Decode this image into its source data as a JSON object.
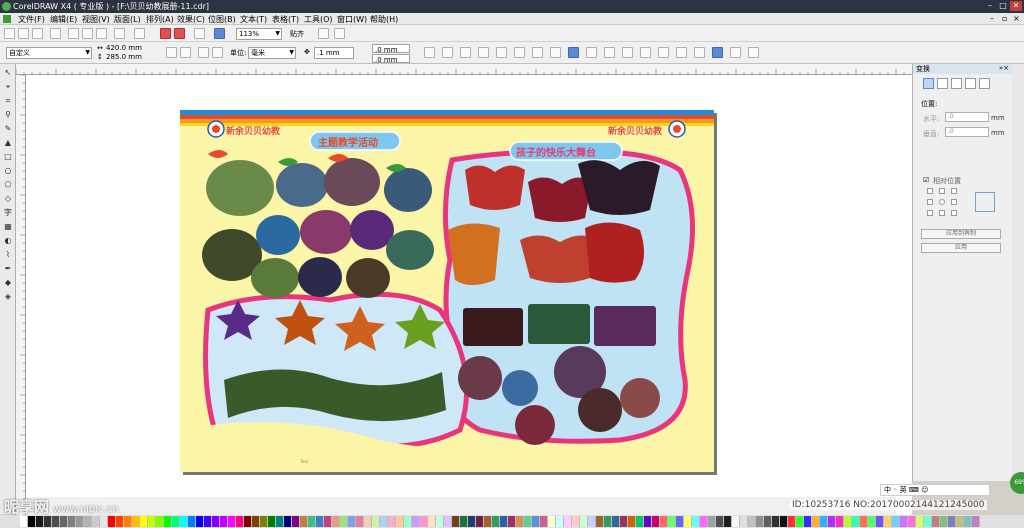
{
  "window": {
    "title": "CorelDRAW X4 ( 专业版 ) - [F:\\贝贝幼教展册-11.cdr]",
    "buttons": [
      "–",
      "□",
      "✕"
    ]
  },
  "menu": [
    "文件(F)",
    "编辑(E)",
    "视图(V)",
    "版面(L)",
    "排列(A)",
    "效果(C)",
    "位图(B)",
    "文本(T)",
    "表格(T)",
    "工具(O)",
    "窗口(W)",
    "帮助(H)"
  ],
  "toolbar": {
    "zoom": "113%",
    "snap_label": "贴齐",
    "page_preset": "自定义",
    "width": "420.0 mm",
    "height": "285.0 mm",
    "units_label": "单位:",
    "units": "毫米",
    "nudge": ".1 mm",
    "dup_x": ".0 mm",
    "dup_y": ".0 mm"
  },
  "docker": {
    "title": "变换",
    "position_label": "位置:",
    "horizontal_label": "水平:",
    "vertical_label": "垂直:",
    "horizontal_value": ".0",
    "vertical_value": ".0",
    "unit": "mm",
    "relative_label": "相对位置",
    "apply_copy": "应用到再制",
    "apply": "应用"
  },
  "poster": {
    "school_name_left": "新余贝贝幼教",
    "school_name_right": "新余贝贝幼教",
    "section1_title": "主题教学活动",
    "section2_title": "孩子的快乐大舞台",
    "bg_color": "#fbf5a8",
    "sky_color": "#bfe2f5",
    "accent_pink": "#e8357c",
    "accent_red": "#e04030"
  },
  "ime": {
    "text": "中 ◦ 英 ⌨ ☺"
  },
  "watermark_left": {
    "logo": "昵享网",
    "site": "www.nipic.cn"
  },
  "watermark_right": "ID:10253716 NO:20170002144121245000",
  "corner_badge": "69%",
  "palette": [
    "#ffffff",
    "#000000",
    "#1a1a1a",
    "#333333",
    "#4d4d4d",
    "#666666",
    "#808080",
    "#999999",
    "#b3b3b3",
    "#cccccc",
    "#e6e6e6",
    "#ff0000",
    "#ff4000",
    "#ff8000",
    "#ffbf00",
    "#ffff00",
    "#bfff00",
    "#80ff00",
    "#00ff00",
    "#00ff80",
    "#00ffff",
    "#0080ff",
    "#0000ff",
    "#4000ff",
    "#8000ff",
    "#bf00ff",
    "#ff00ff",
    "#ff0080",
    "#800000",
    "#804000",
    "#808000",
    "#008000",
    "#008080",
    "#000080",
    "#800080",
    "#c08040",
    "#40c080",
    "#4080c0",
    "#c04080",
    "#e0a080",
    "#a0e080",
    "#80a0e0",
    "#e080a0",
    "#f0d0b0",
    "#d0f0b0",
    "#b0d0f0",
    "#f0b0d0",
    "#ffcc99",
    "#99ffcc",
    "#cc99ff",
    "#ff99cc",
    "#ffe0c0",
    "#c0ffe0",
    "#e0c0ff",
    "#704020",
    "#207040",
    "#204070",
    "#702040",
    "#a06030",
    "#30a060",
    "#3060a0",
    "#a03060",
    "#d09060",
    "#60d090",
    "#6090d0",
    "#d06090",
    "#ffffcc",
    "#ccffff",
    "#ffccff",
    "#ffcccc",
    "#ccffcc",
    "#ccccff",
    "#996633",
    "#339966",
    "#336699",
    "#993366",
    "#cc6600",
    "#00cc66",
    "#6600cc",
    "#cc0066",
    "#ff6666",
    "#66ff66",
    "#6666ff",
    "#ffff66",
    "#66ffff",
    "#ff66ff",
    "#a0a0a0",
    "#505050",
    "#202020",
    "#f8f8f8",
    "#e0e0e0",
    "#c0c0c0",
    "#909090",
    "#606060",
    "#303030",
    "#101010",
    "#ff3030",
    "#30ff30",
    "#3030ff",
    "#ffb030",
    "#30b0ff",
    "#b030ff",
    "#ff30b0",
    "#b0ff30",
    "#30ffb0",
    "#ff7050",
    "#50ff70",
    "#7050ff",
    "#ffd070",
    "#70d0ff",
    "#d070ff",
    "#ff70d0",
    "#d0ff70",
    "#70ffd0",
    "#c08080",
    "#80c080",
    "#8080c0",
    "#c0c080",
    "#80c0c0",
    "#c080c0"
  ]
}
